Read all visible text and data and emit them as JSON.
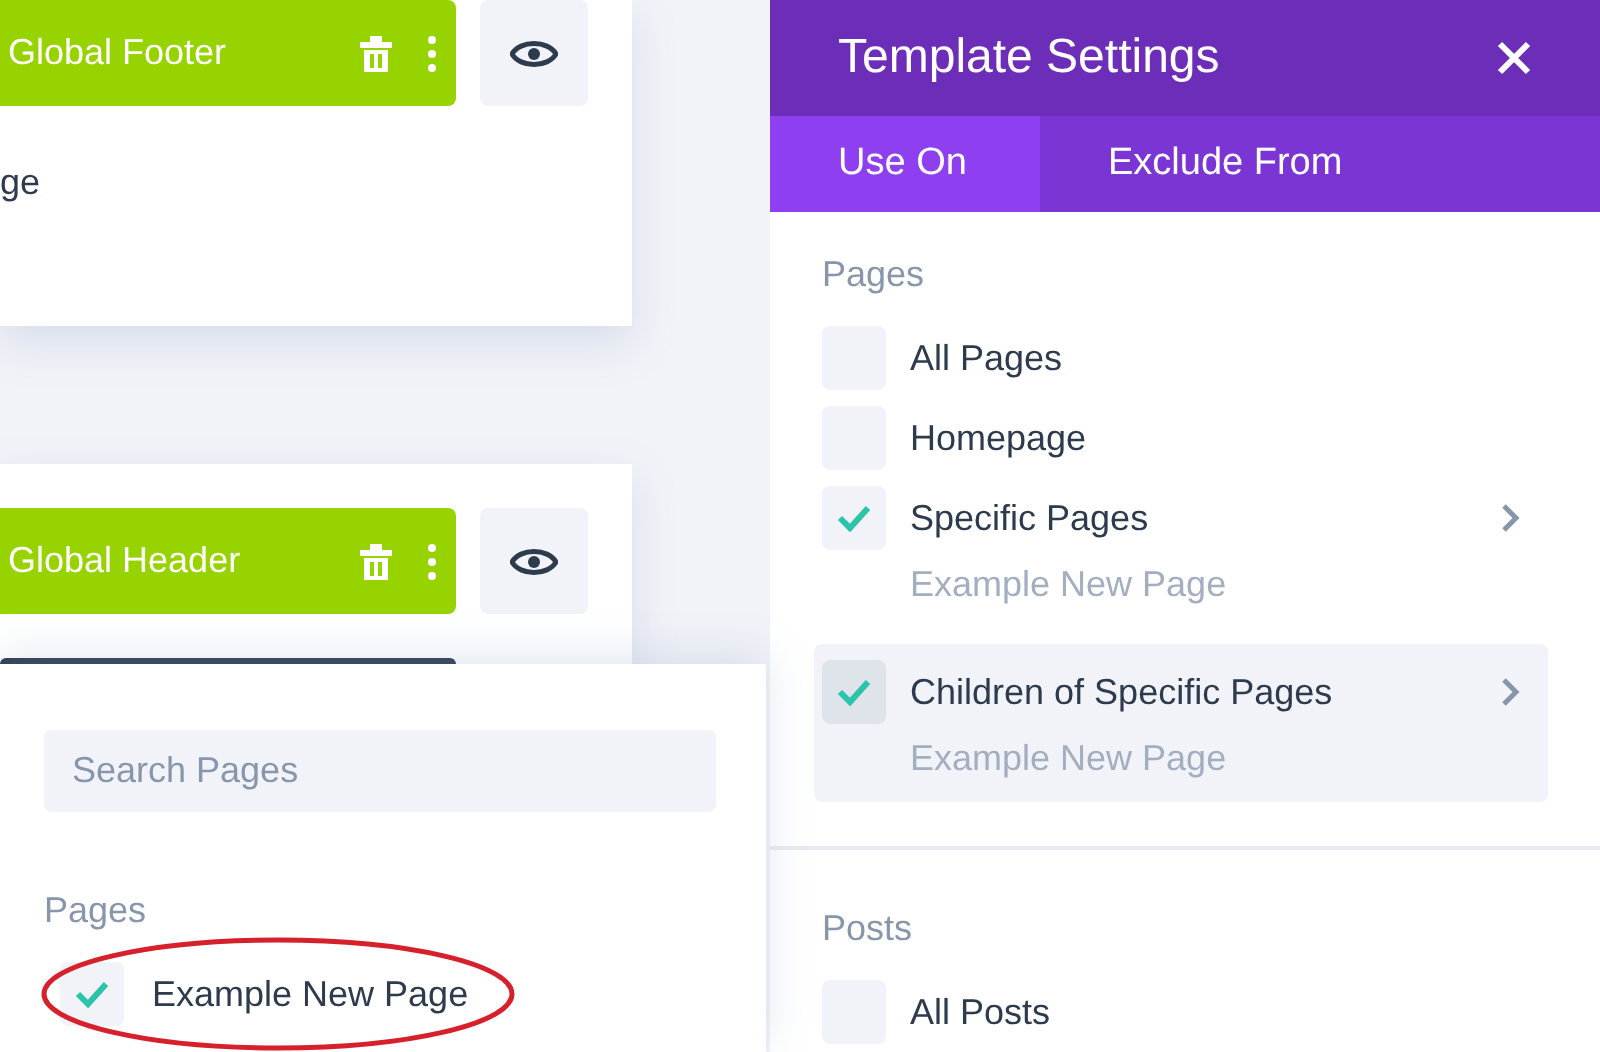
{
  "layouts": [
    {
      "title": "Global Footer",
      "text": "ge"
    },
    {
      "title": "Global Header"
    }
  ],
  "page_picker": {
    "search": {
      "placeholder": "Search Pages"
    },
    "heading": "Pages",
    "items": [
      {
        "label": "Example New Page",
        "checked": true,
        "highlighted": true
      }
    ]
  },
  "template_settings": {
    "title": "Template Settings",
    "tabs": [
      {
        "label": "Use On",
        "selected": true
      },
      {
        "label": "Exclude From",
        "selected": false
      }
    ],
    "sections": [
      {
        "heading": "Pages",
        "items": [
          {
            "label": "All Pages",
            "checked": false,
            "selected": false,
            "expandable": false
          },
          {
            "label": "Homepage",
            "checked": false,
            "selected": false,
            "expandable": false
          },
          {
            "label": "Specific Pages",
            "checked": true,
            "selected": false,
            "expandable": true,
            "detail": "Example New Page"
          },
          {
            "label": "Children of Specific Pages",
            "checked": true,
            "selected": true,
            "expandable": true,
            "detail": "Example New Page"
          }
        ]
      },
      {
        "heading": "Posts",
        "items": [
          {
            "label": "All Posts",
            "checked": false,
            "selected": false,
            "expandable": false
          }
        ]
      }
    ]
  }
}
